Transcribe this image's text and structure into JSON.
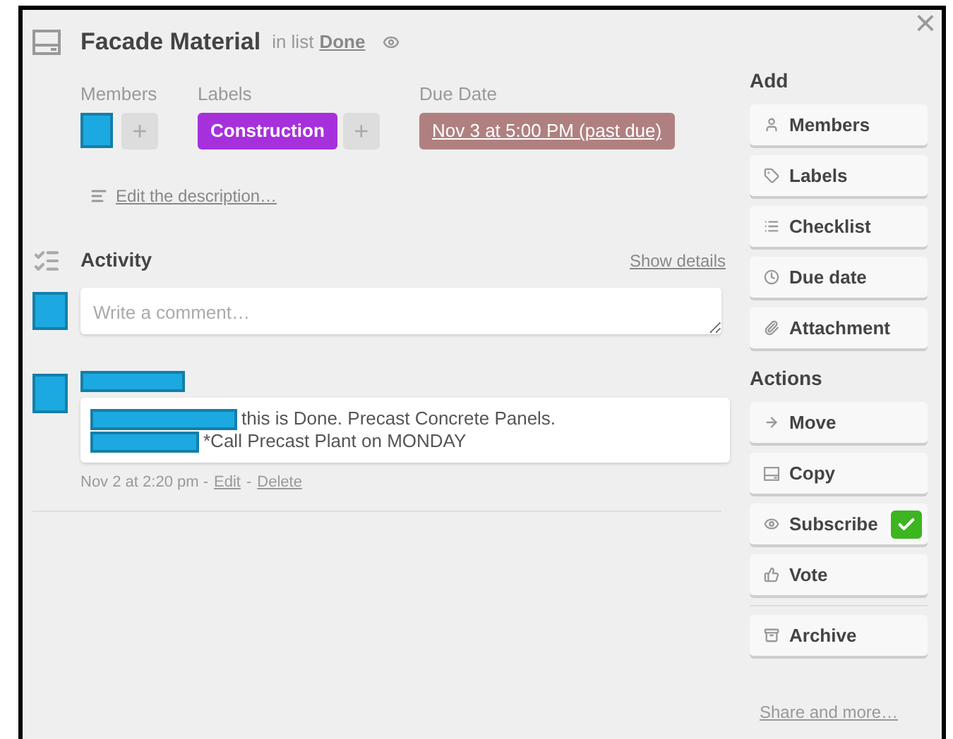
{
  "card": {
    "title": "Facade Material",
    "list_prefix": "in list",
    "list_name": "Done"
  },
  "members": {
    "heading": "Members",
    "add": "+"
  },
  "labels": {
    "heading": "Labels",
    "items": [
      {
        "text": "Construction",
        "color": "#a630dc"
      }
    ],
    "add": "+"
  },
  "due_date": {
    "heading": "Due Date",
    "value": "Nov 3 at 5:00 PM (past due)",
    "past_due": true
  },
  "description": {
    "link": "Edit the description…"
  },
  "activity": {
    "heading": "Activity",
    "toggle": "Show details",
    "comment_placeholder": "Write a comment…",
    "entries": [
      {
        "lines": [
          "this is Done. Precast Concrete Panels.",
          "*Call Precast Plant on MONDAY"
        ],
        "time": "Nov 2 at 2:20 pm -",
        "edit": "Edit",
        "separator": "-",
        "delete": "Delete"
      }
    ]
  },
  "close": "×",
  "sidebar": [
    {
      "heading": "Add",
      "buttons": [
        {
          "label": "Members",
          "kind": "button"
        },
        {
          "label": "Labels",
          "kind": "button"
        },
        {
          "label": "Checklist",
          "kind": "button"
        },
        {
          "label": "Due date",
          "kind": "button"
        },
        {
          "label": "Attachment",
          "kind": "button"
        }
      ]
    },
    {
      "heading": "Actions",
      "buttons": [
        {
          "label": "Move",
          "kind": "button"
        },
        {
          "label": "Copy",
          "kind": "button"
        },
        {
          "label": "Subscribe",
          "kind": "toggle",
          "checked": true
        },
        {
          "label": "Vote",
          "kind": "button"
        },
        {
          "label": "Archive",
          "kind": "button"
        }
      ]
    }
  ],
  "share": "Share and more…"
}
